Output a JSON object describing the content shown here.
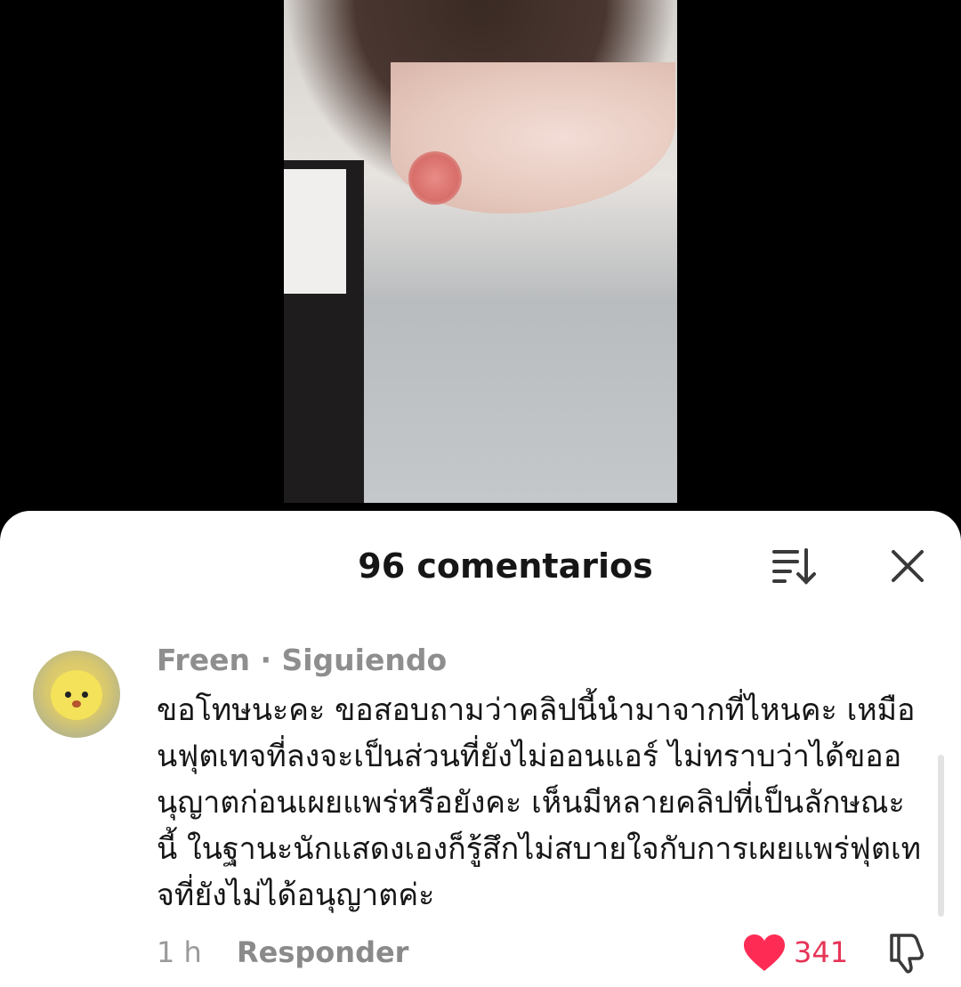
{
  "sheet": {
    "title": "96 comentarios"
  },
  "comment": {
    "author": "Freen · Siguiendo",
    "text": "ขอโทษนะคะ ขอสอบถามว่าคลิปนี้นำมาจากที่ไหนคะ เหมือนฟุตเทจที่ลงจะเป็นส่วนที่ยังไม่ออนแอร์ ไม่ทราบว่าได้ขออนุญาตก่อนเผยแพร่หรือยังคะ เห็นมีหลายคลิปที่เป็นลักษณะนี้ ในฐานะนักแสดงเองก็รู้สึกไม่สบายใจกับการเผยแพร่ฟุตเทจที่ยังไม่ได้อนุญาตค่ะ",
    "time": "1 h",
    "reply_label": "Responder",
    "like_count": "341"
  },
  "icons": {
    "sort": "sort-icon",
    "close": "close-icon",
    "like": "heart-icon",
    "dislike": "thumbs-down-icon"
  },
  "colors": {
    "like": "#fe2c55",
    "text": "#161616",
    "muted": "#8e8e8e"
  }
}
